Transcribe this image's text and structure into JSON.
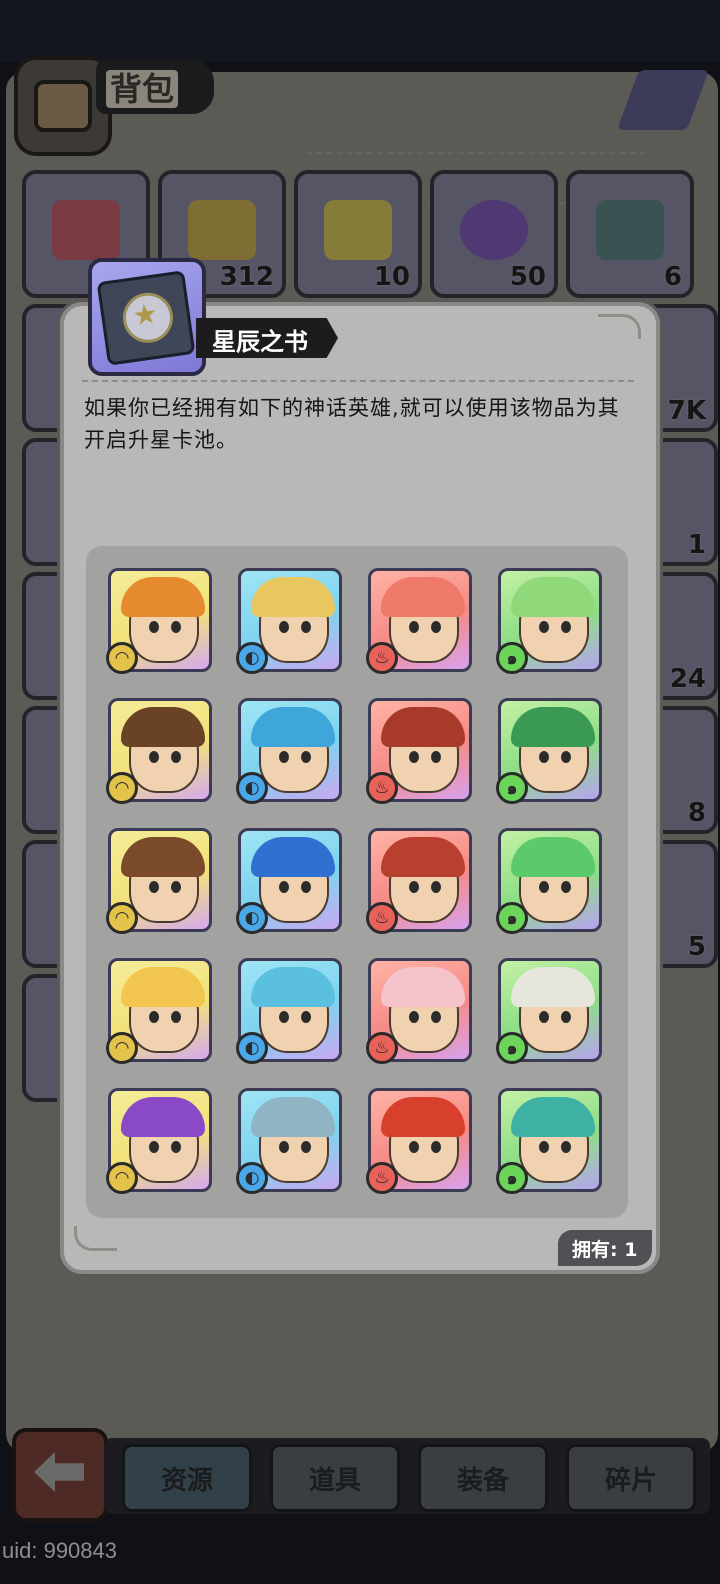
{
  "backpack": {
    "title": "背包",
    "top_row": [
      {
        "icon": "red-gem-icon",
        "qty": "",
        "color": "#8b3f4a"
      },
      {
        "icon": "gold-gem-icon",
        "qty": "312",
        "color": "#8a7a3a"
      },
      {
        "icon": "match-ticket-icon",
        "qty": "10",
        "color": "#8f8640"
      },
      {
        "icon": "purple-crest-icon",
        "qty": "50",
        "color": "#5a3f7a"
      },
      {
        "icon": "helmet-book-icon",
        "qty": "6",
        "color": "#3f5a5a"
      }
    ],
    "side_quantities": [
      "7K",
      "1",
      "24",
      "8",
      "5"
    ]
  },
  "tabs": [
    {
      "label": "资源",
      "active": true
    },
    {
      "label": "道具",
      "active": false
    },
    {
      "label": "装备",
      "active": false
    },
    {
      "label": "碎片",
      "active": false
    }
  ],
  "uid": "uid: 990843",
  "popup": {
    "item_name": "星辰之书",
    "item_icon": "star-book-icon",
    "description": "如果你已经拥有如下的神话英雄,就可以使用该物品为其开启升星卡池。",
    "owned_label": "拥有:",
    "owned_count": "1",
    "heroes": [
      {
        "id": "tiger-warrior",
        "element": "earth",
        "hair": "#e58a2e"
      },
      {
        "id": "golden-valkyrie",
        "element": "water",
        "hair": "#e9c760"
      },
      {
        "id": "rose-princess",
        "element": "fire",
        "hair": "#f07a6a"
      },
      {
        "id": "forest-empress",
        "element": "wind",
        "hair": "#8fd97a"
      },
      {
        "id": "goggle-engineer",
        "element": "earth",
        "hair": "#6a4226"
      },
      {
        "id": "blue-elf-knight",
        "element": "water",
        "hair": "#3fa6d9"
      },
      {
        "id": "red-bandana-rogue",
        "element": "fire",
        "hair": "#a83a2a"
      },
      {
        "id": "green-sage",
        "element": "wind",
        "hair": "#3a9a54"
      },
      {
        "id": "jade-crown-hero",
        "element": "earth",
        "hair": "#7a4a2a"
      },
      {
        "id": "azure-prince",
        "element": "water",
        "hair": "#2f6fd0"
      },
      {
        "id": "war-chief",
        "element": "fire",
        "hair": "#b8402e"
      },
      {
        "id": "emerald-elf",
        "element": "wind",
        "hair": "#5cc96a"
      },
      {
        "id": "blonde-maiden",
        "element": "earth",
        "hair": "#f2c64e"
      },
      {
        "id": "aqua-elf",
        "element": "water",
        "hair": "#5bc0e0"
      },
      {
        "id": "pink-fox-girl",
        "element": "fire",
        "hair": "#f4c3cc"
      },
      {
        "id": "white-beard-elder",
        "element": "wind",
        "hair": "#e6e6dc"
      },
      {
        "id": "violet-sorceress",
        "element": "earth",
        "hair": "#8a4ac8"
      },
      {
        "id": "shark-brute",
        "element": "water",
        "hair": "#8fb4c4"
      },
      {
        "id": "dragon-mask",
        "element": "fire",
        "hair": "#d8402e"
      },
      {
        "id": "teal-priestess",
        "element": "wind",
        "hair": "#3fb0a4"
      }
    ],
    "element_glyphs": {
      "earth": "◠",
      "water": "◐",
      "fire": "♨",
      "wind": "๑"
    }
  }
}
